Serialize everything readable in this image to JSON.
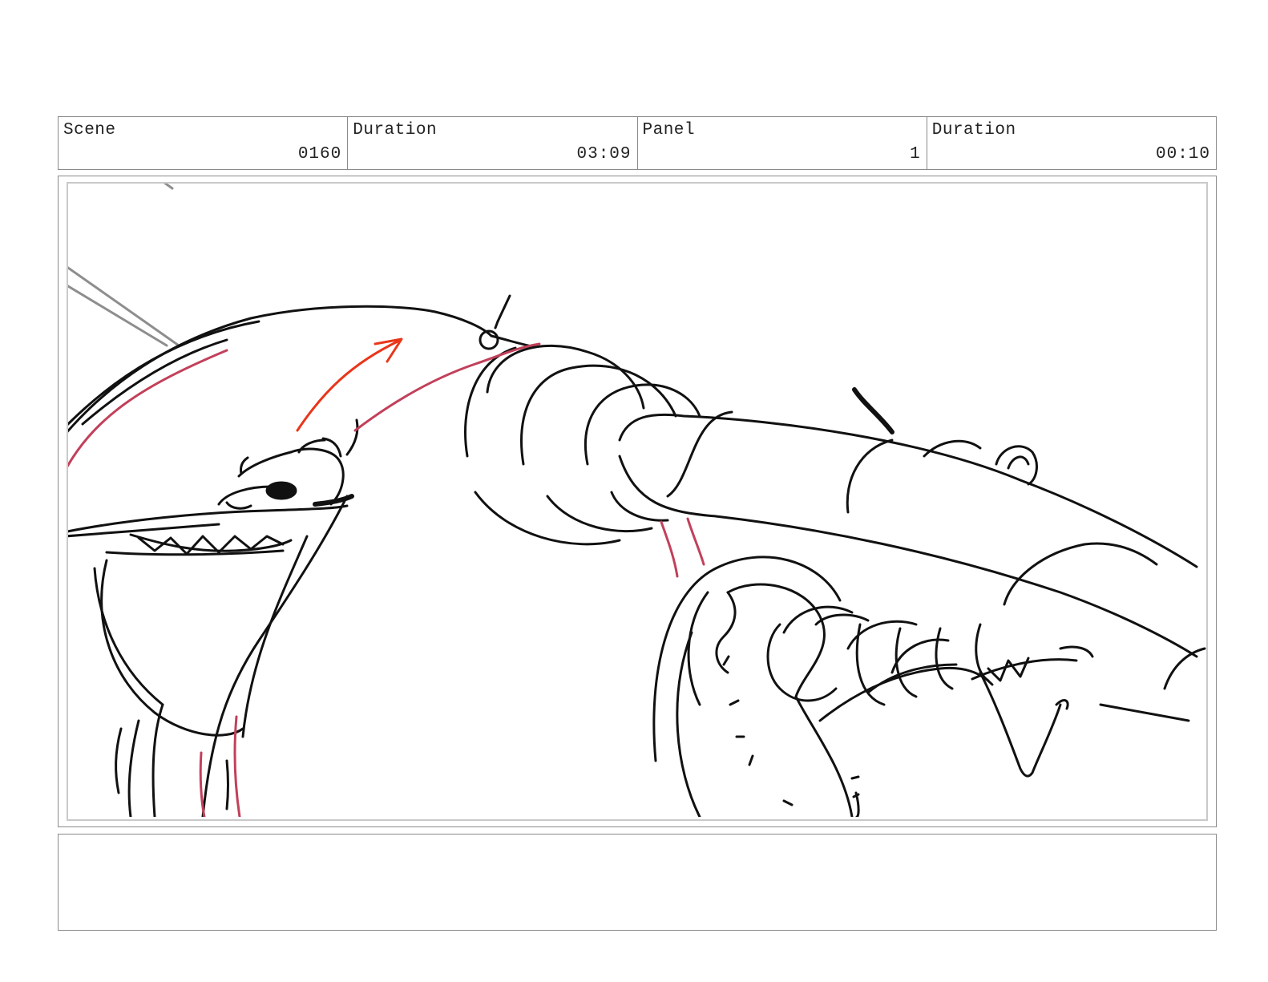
{
  "header": {
    "scene_label": "Scene",
    "scene_value": "0160",
    "scene_duration_label": "Duration",
    "scene_duration_value": "03:09",
    "panel_label": "Panel",
    "panel_value": "1",
    "panel_duration_label": "Duration",
    "panel_duration_value": "00:10"
  },
  "panel": {
    "ink_color": "#111111",
    "guide_color": "#8e8e8e",
    "accent_color": "#c2405a",
    "arrow_color": "#e8361a"
  },
  "notes": {
    "text": ""
  }
}
